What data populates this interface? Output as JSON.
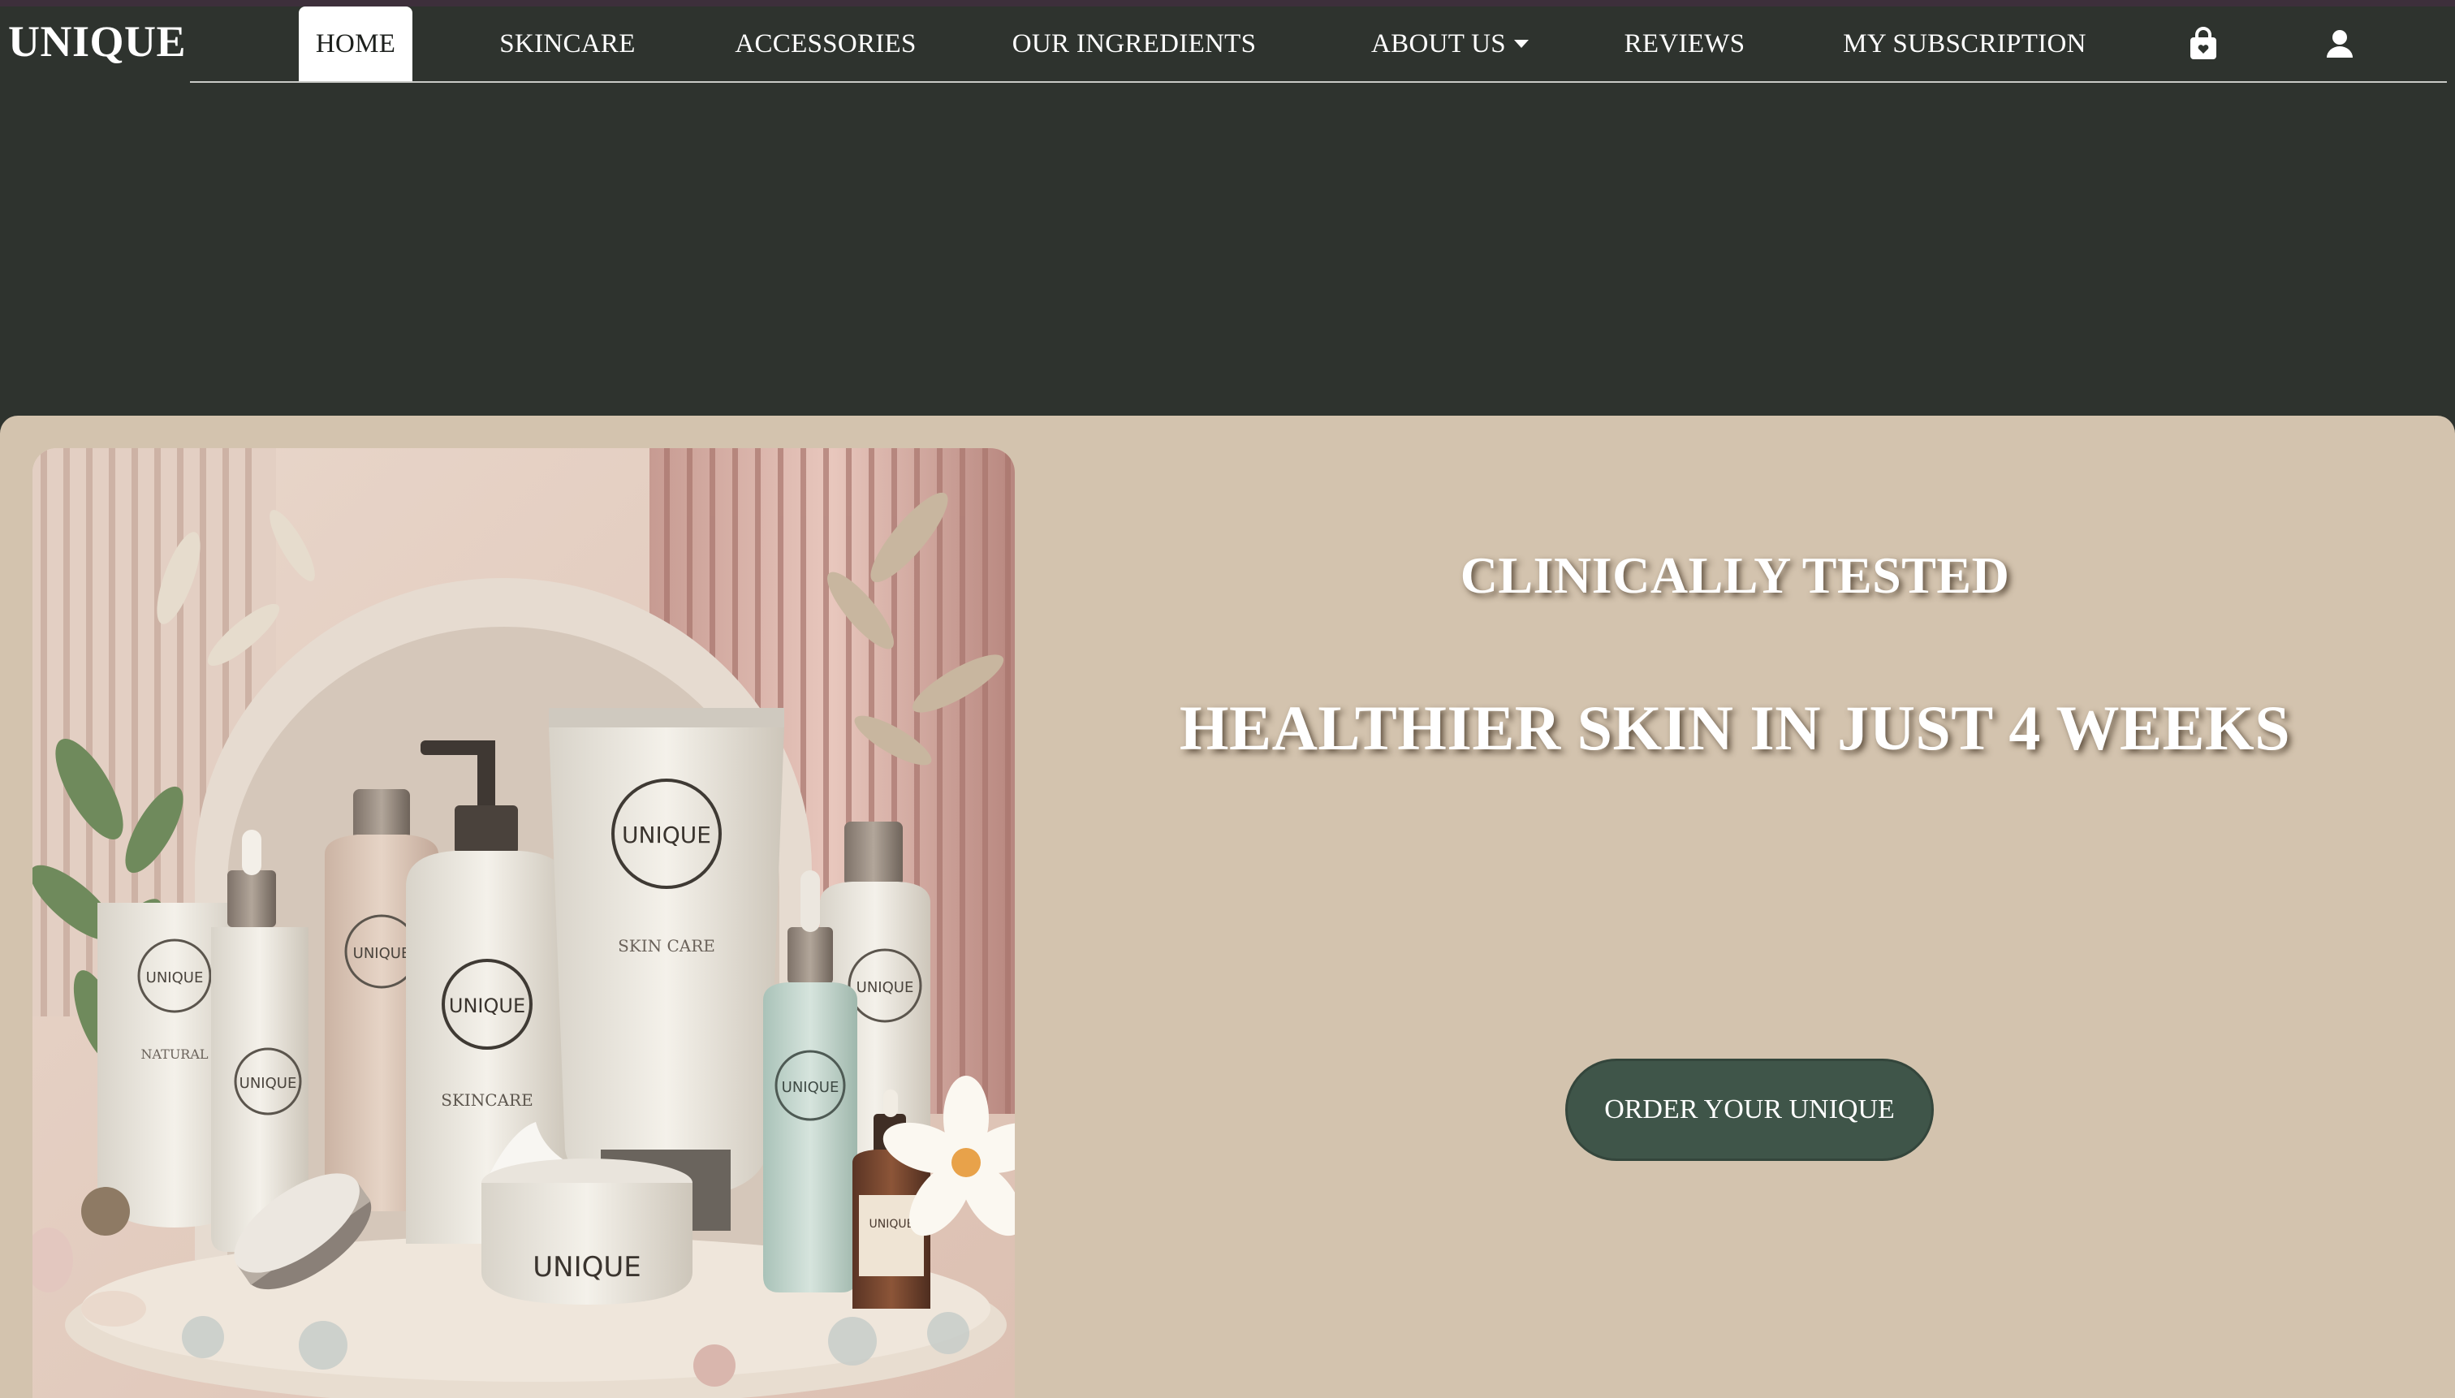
{
  "brand": {
    "name": "UNIQUE"
  },
  "nav": {
    "items": [
      {
        "label": "HOME",
        "active": true
      },
      {
        "label": "SKINCARE"
      },
      {
        "label": "ACCESSORIES"
      },
      {
        "label": "OUR INGREDIENTS"
      },
      {
        "label": "ABOUT US",
        "has_dropdown": true
      },
      {
        "label": "REVIEWS"
      },
      {
        "label": "MY SUBSCRIPTION"
      }
    ],
    "icons": [
      "shopping-bag-icon",
      "user-icon"
    ]
  },
  "hero": {
    "tagline": "CLINICALLY TESTED",
    "headline": "HEALTHIER SKIN IN JUST 4 WEEKS",
    "cta_label": "ORDER YOUR UNIQUE",
    "product_labels": {
      "tube": "UNIQUE",
      "tube_sub": "SKIN CARE",
      "pump": "UNIQUE",
      "pump_sub": "SKINCARE",
      "jar": "UNIQUE",
      "left_tube": "UNIQUE",
      "left_tube_sub": "NATURAL",
      "dropper_left": "UNIQUE",
      "bottle_tall": "UNIQUE",
      "bottle_right": "UNIQUE",
      "glass_bottle": "UNIQUE",
      "amber_bottle": "UNIQUE"
    }
  },
  "colors": {
    "header_bg": "#2e332e",
    "hero_bg": "#d3c3ae",
    "cta_bg": "#3f5549",
    "top_stripe": "#3d2f3b"
  }
}
